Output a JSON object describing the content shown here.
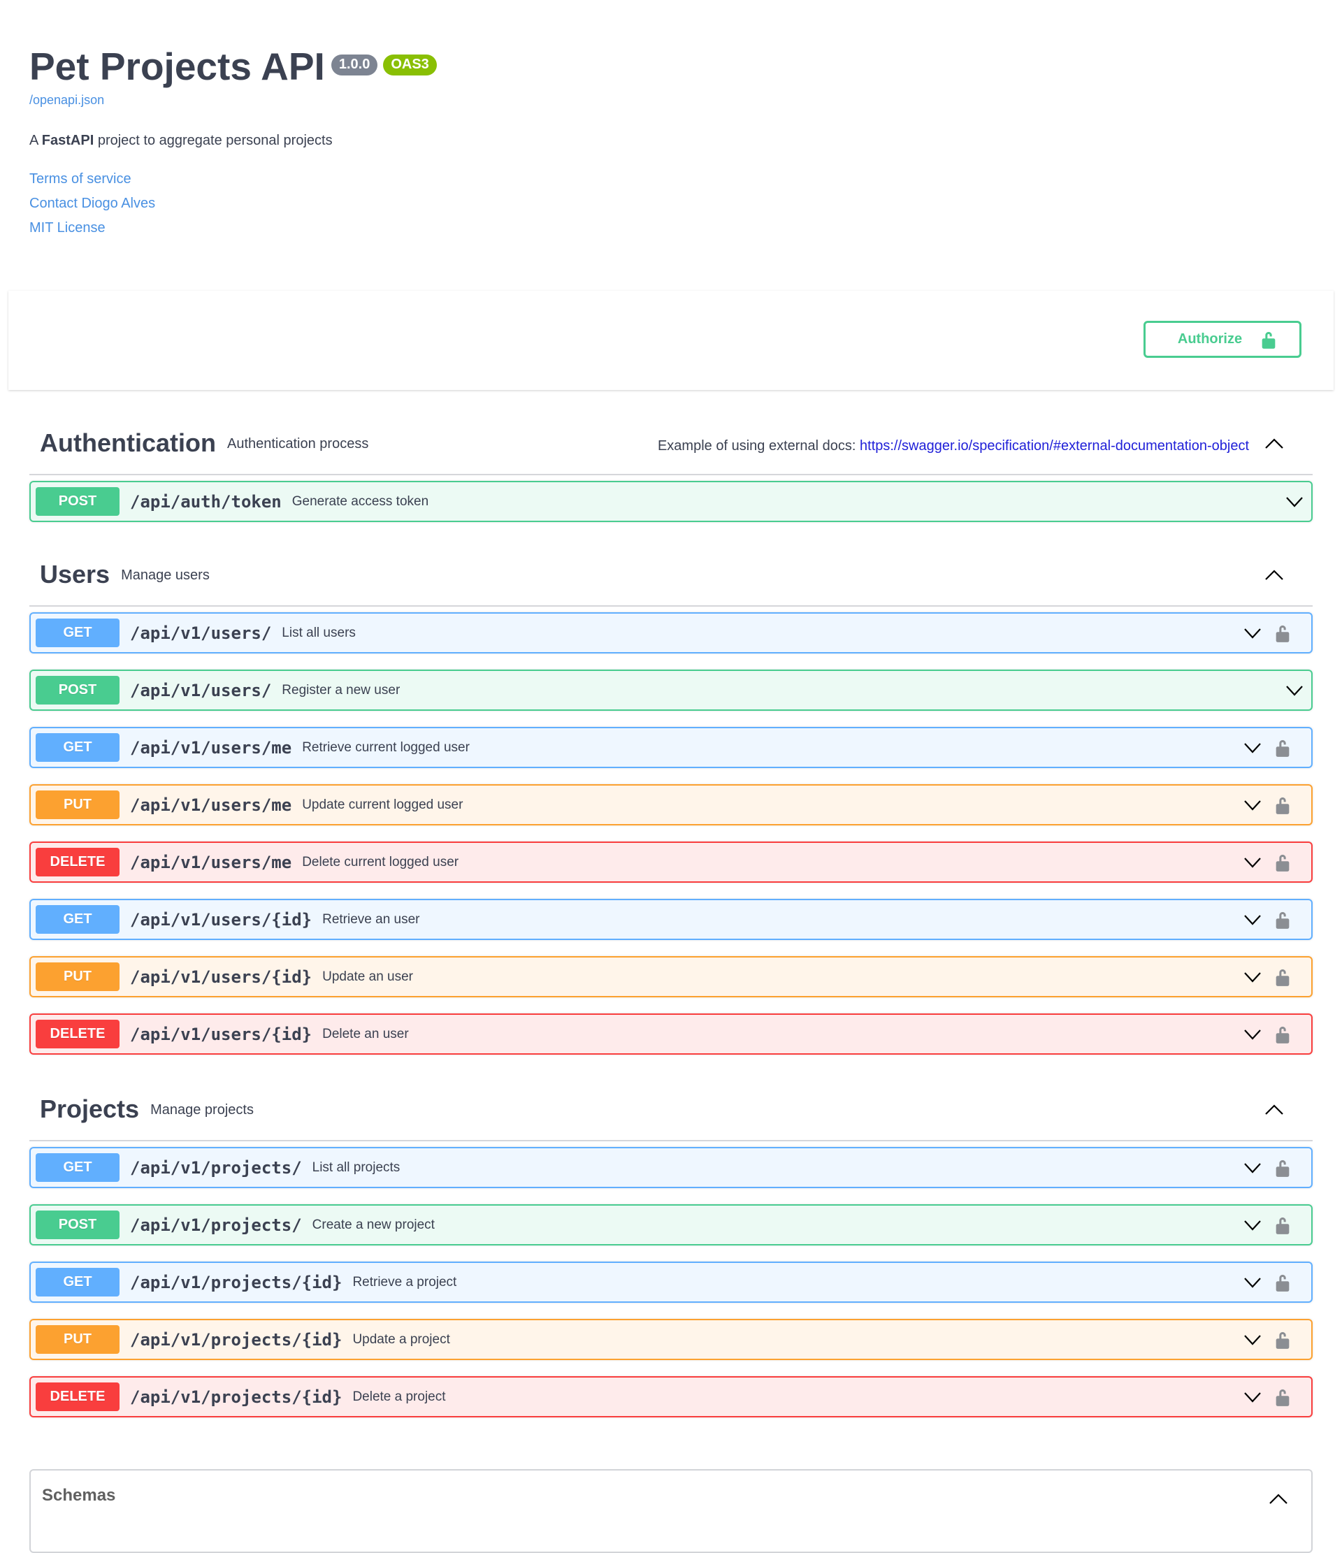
{
  "info": {
    "title": "Pet Projects API",
    "version": "1.0.0",
    "oas_badge": "OAS3",
    "spec_link": "/openapi.json",
    "description_prefix": "A ",
    "description_bold": "FastAPI",
    "description_suffix": " project to aggregate personal projects",
    "links": [
      {
        "label": "Terms of service"
      },
      {
        "label": "Contact Diogo Alves"
      },
      {
        "label": "MIT License"
      }
    ]
  },
  "colors": {
    "get": "#61affe",
    "post": "#49cc90",
    "put": "#fca130",
    "delete": "#f93e3e",
    "link": "#4990e2",
    "version_badge": "#7d8492",
    "oas_badge": "#89bf04"
  },
  "authorize": {
    "label": "Authorize",
    "icon": "unlock-icon"
  },
  "tags": [
    {
      "name": "Authentication",
      "description": "Authentication process",
      "external_docs_label": "Example of using external docs: ",
      "external_docs_url": "https://swagger.io/specification/#external-documentation-object",
      "expanded": true,
      "operations": [
        {
          "method": "POST",
          "path": "/api/auth/token",
          "summary": "Generate access token",
          "locked": false
        }
      ]
    },
    {
      "name": "Users",
      "description": "Manage users",
      "expanded": true,
      "operations": [
        {
          "method": "GET",
          "path": "/api/v1/users/",
          "summary": "List all users",
          "locked": true
        },
        {
          "method": "POST",
          "path": "/api/v1/users/",
          "summary": "Register a new user",
          "locked": false
        },
        {
          "method": "GET",
          "path": "/api/v1/users/me",
          "summary": "Retrieve current logged user",
          "locked": true
        },
        {
          "method": "PUT",
          "path": "/api/v1/users/me",
          "summary": "Update current logged user",
          "locked": true
        },
        {
          "method": "DELETE",
          "path": "/api/v1/users/me",
          "summary": "Delete current logged user",
          "locked": true
        },
        {
          "method": "GET",
          "path": "/api/v1/users/{id}",
          "summary": "Retrieve an user",
          "locked": true
        },
        {
          "method": "PUT",
          "path": "/api/v1/users/{id}",
          "summary": "Update an user",
          "locked": true
        },
        {
          "method": "DELETE",
          "path": "/api/v1/users/{id}",
          "summary": "Delete an user",
          "locked": true
        }
      ]
    },
    {
      "name": "Projects",
      "description": "Manage projects",
      "expanded": true,
      "operations": [
        {
          "method": "GET",
          "path": "/api/v1/projects/",
          "summary": "List all projects",
          "locked": true
        },
        {
          "method": "POST",
          "path": "/api/v1/projects/",
          "summary": "Create a new project",
          "locked": true
        },
        {
          "method": "GET",
          "path": "/api/v1/projects/{id}",
          "summary": "Retrieve a project",
          "locked": true
        },
        {
          "method": "PUT",
          "path": "/api/v1/projects/{id}",
          "summary": "Update a project",
          "locked": true
        },
        {
          "method": "DELETE",
          "path": "/api/v1/projects/{id}",
          "summary": "Delete a project",
          "locked": true
        }
      ]
    }
  ],
  "schemas": {
    "title": "Schemas",
    "expanded": true
  }
}
